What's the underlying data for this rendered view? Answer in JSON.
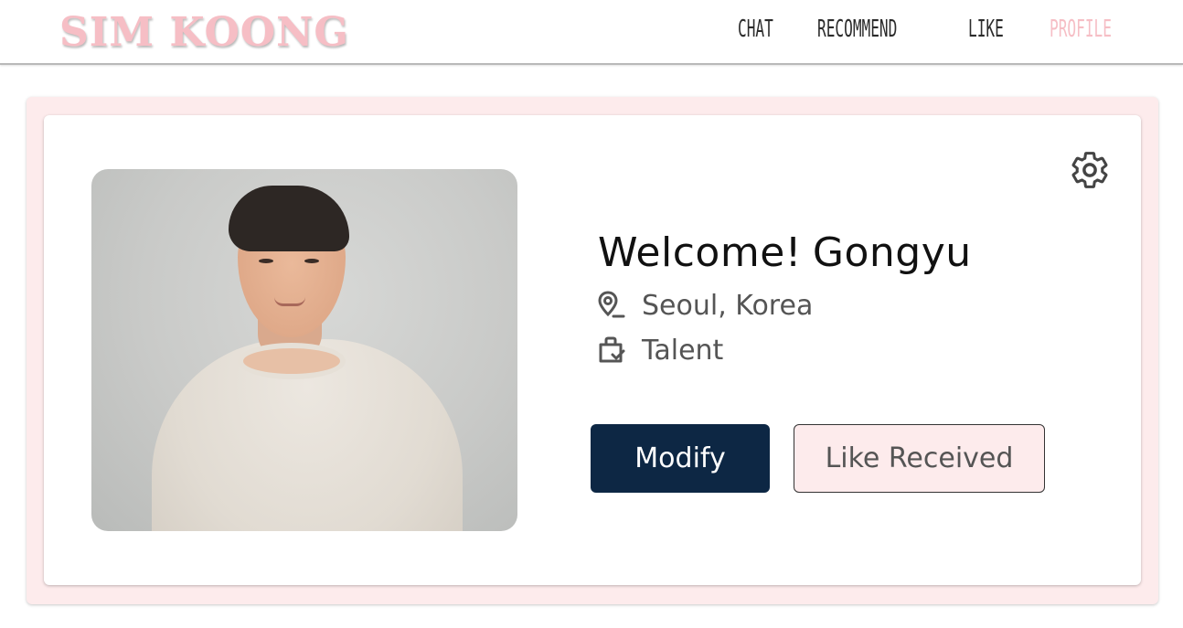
{
  "header": {
    "brand": "SIM KOONG",
    "nav": {
      "chat": "CHAT",
      "recommend": "RECOMMEND",
      "like": "LIKE",
      "profile": "PROFILE"
    },
    "active_tab": "profile"
  },
  "profile": {
    "greeting": "Welcome!",
    "name": "Gongyu",
    "location": "Seoul, Korea",
    "job": "Talent",
    "icons": {
      "location": "location-pin-icon",
      "job": "briefcase-icon",
      "settings": "gear-icon"
    },
    "buttons": {
      "modify": "Modify",
      "like_received": "Like Received"
    }
  },
  "colors": {
    "brand_pink": "#f6bec5",
    "card_pink": "#fdebec",
    "navy": "#0d2744",
    "text_gray": "#555555"
  }
}
